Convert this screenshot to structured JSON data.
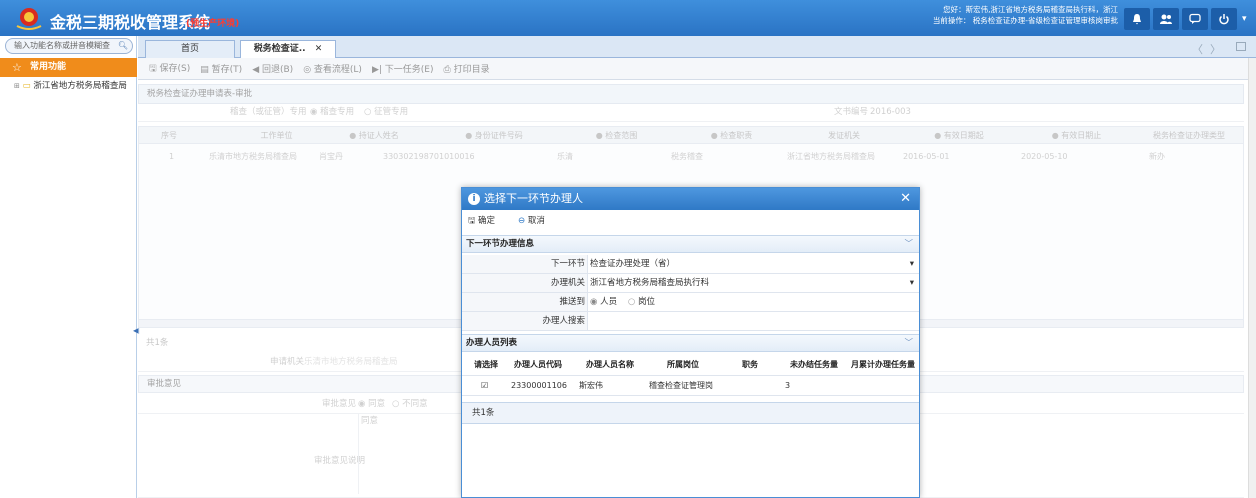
{
  "header": {
    "app_title": "金税三期税收管理系统",
    "env_badge": "(预生产环境)",
    "user_line1": "您好：斯宏伟,浙江省地方税务局稽查局执行科，浙江",
    "user_line2": "当前操作： 税务检查证办理-省级检查证管理审核岗审批"
  },
  "sidebar": {
    "search_placeholder": "输入功能名称或拼音模糊查",
    "favorites_label": "常用功能",
    "tree_root_label": "浙江省地方税务局稽查局"
  },
  "tabs": [
    {
      "label": "首页"
    },
    {
      "label": "税务检查证.."
    }
  ],
  "toolbar": {
    "save": "保存(S)",
    "temp": "暂存(T)",
    "back": "回退(B)",
    "flow": "查看流程(L)",
    "next": "下一任务(E)",
    "print": "打印目录"
  },
  "form": {
    "title": "税务检查证办理申请表-审批",
    "type_label": "稽查（或征管）专用",
    "type_opt1": "稽查专用",
    "type_opt2": "征管专用",
    "doc_no_label": "文书编号",
    "doc_no": "2016-003",
    "grid_headers": [
      "序号",
      "工作单位",
      "● 持证人姓名",
      "● 身份证件号码",
      "● 检查范围",
      "● 检查职责",
      "发证机关",
      "● 有效日期起",
      "● 有效日期止",
      "税务检查证办理类型"
    ],
    "grid_row": [
      "1",
      "乐清市地方税务局稽查局",
      "肖宝丹",
      "330302198701010016",
      "乐清",
      "税务稽查",
      "浙江省地方税务局稽查局",
      "2016-05-01",
      "2020-05-10",
      "新办"
    ],
    "count_text": "共1条",
    "apply_org_label": "申请机关",
    "apply_org": "乐清市地方税务局稽查局",
    "opinion_section": "审批意见",
    "opinion_label": "审批意见",
    "opinion_agree": "同意",
    "opinion_disagree": "不同意",
    "opinion_desc_label": "审批意见说明",
    "opinion_desc": "同意"
  },
  "dialog": {
    "title": "选择下一环节办理人",
    "confirm": "确定",
    "cancel": "取消",
    "info_section": "下一环节办理信息",
    "next_step_label": "下一环节",
    "next_step_value": "检查证办理处理（省）",
    "org_label": "办理机关",
    "org_value": "浙江省地方税务局稽查局执行科",
    "push_label": "推送到",
    "push_opt1": "人员",
    "push_opt2": "岗位",
    "search_label": "办理人搜索",
    "list_section": "办理人员列表",
    "table_headers": [
      "请选择",
      "办理人员代码",
      "办理人员名称",
      "所属岗位",
      "职务",
      "未办结任务量",
      "月累计办理任务量"
    ],
    "table_row": {
      "code": "23300001106",
      "name": "斯宏伟",
      "post": "稽查检查证管理岗",
      "duty": "",
      "pending": "3",
      "monthly": ""
    },
    "count_text": "共1条"
  }
}
